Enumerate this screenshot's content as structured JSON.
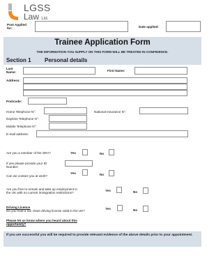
{
  "logo": {
    "line1": "LGSS",
    "line2": "Law",
    "suffix": "Ltd."
  },
  "header": {
    "post_applied_label": "Post Applied\nfor:",
    "date_applied_label": "Date applied:"
  },
  "title": {
    "main": "Trainee Application Form",
    "notice": "THE INFORMATION YOU SUPPLY ON THIS FORM WILL BE TREATED IN CONFIDENCE."
  },
  "section": {
    "number": "Section 1",
    "name": "Personal details"
  },
  "fields": {
    "last_name": "Last\nName:",
    "first_name": "First Name:",
    "address": "Address:",
    "postcode": "Postcode:",
    "home_tel": "Home Telephone N°:",
    "ni": "National Insurance N°:",
    "daytime_tel": "Daytime Telephone N°:",
    "mobile_tel": "Mobile Telephone N°:",
    "email": "E-mail address:"
  },
  "questions": {
    "sra": "Are you a member of the SRA?",
    "id_number": "If yes please provide your ID\nNumber:",
    "contact_work": "Can we contact you at work?",
    "free_remain": "Are you free to remain and take up employment in\nthe UK with no current immigration restrictions?",
    "driving_title": "Driving Licence",
    "driving_question": "Do you hold a full, clean driving license valid in the UK?",
    "heard_about": "Please let us know where you heard about this\nopportunity?"
  },
  "options": {
    "yes": "Yes",
    "no": "No"
  },
  "footer": {
    "text": "If you are successful you will be required to provide relevant evidence of the above details prior to your appointment."
  },
  "colors": {
    "band": "#d6dee8",
    "logo_arc": "#f08a24",
    "logo_bar": "#b7b7b7"
  }
}
